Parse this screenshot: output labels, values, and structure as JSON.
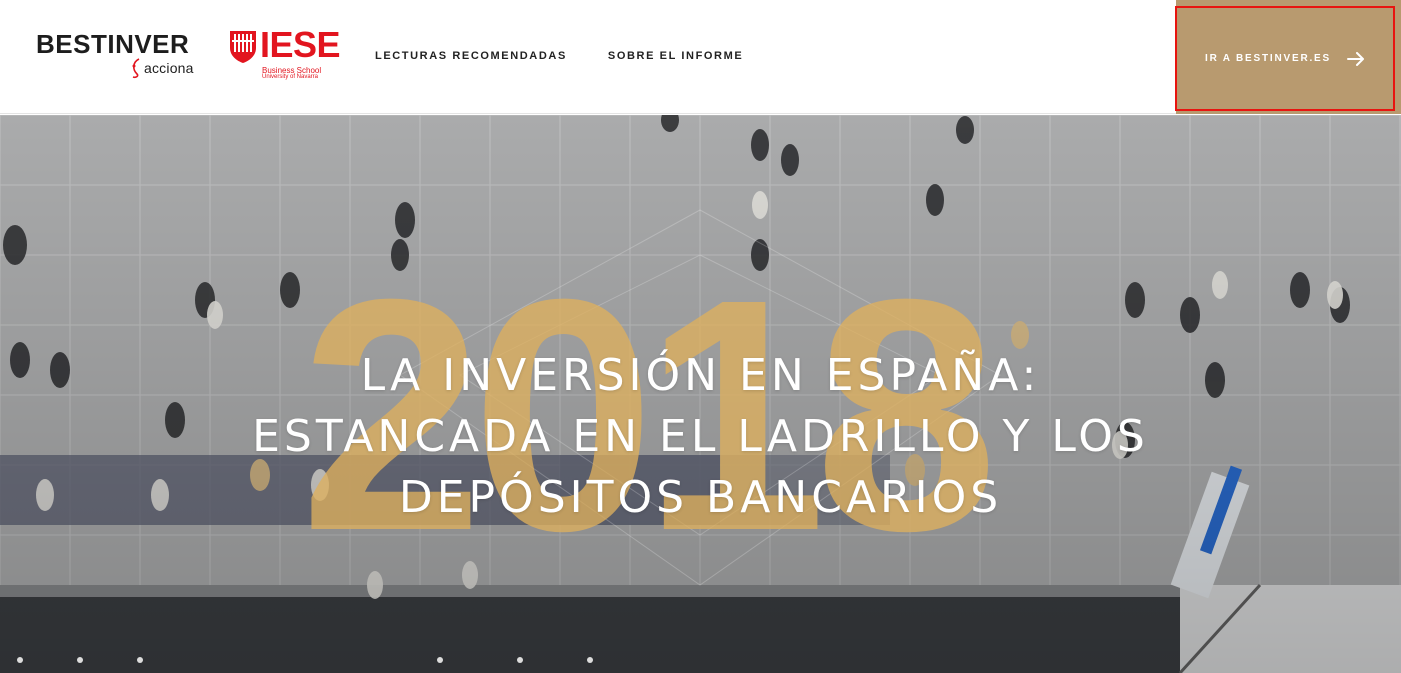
{
  "header": {
    "brand": {
      "name": "BESTINVER",
      "tagline": "acciona"
    },
    "partner": {
      "name": "IESE",
      "line1": "Business School",
      "line2": "University of Navarra"
    },
    "nav": [
      {
        "label": "LECTURAS RECOMENDADAS"
      },
      {
        "label": "SOBRE EL INFORME"
      }
    ],
    "cta": {
      "label": "IR A BESTINVER.ES",
      "icon": "arrow-right-icon"
    }
  },
  "hero": {
    "year": "2018",
    "title_lines": [
      "LA INVERSIÓN EN ESPAÑA:",
      "ESTANCADA EN EL LADRILLO Y LOS",
      "DEPÓSITOS BANCARIOS"
    ]
  },
  "colors": {
    "accent": "#b89a6f",
    "iese_red": "#e2151f",
    "year_overlay": "#deb05e",
    "title": "#ffffff"
  }
}
